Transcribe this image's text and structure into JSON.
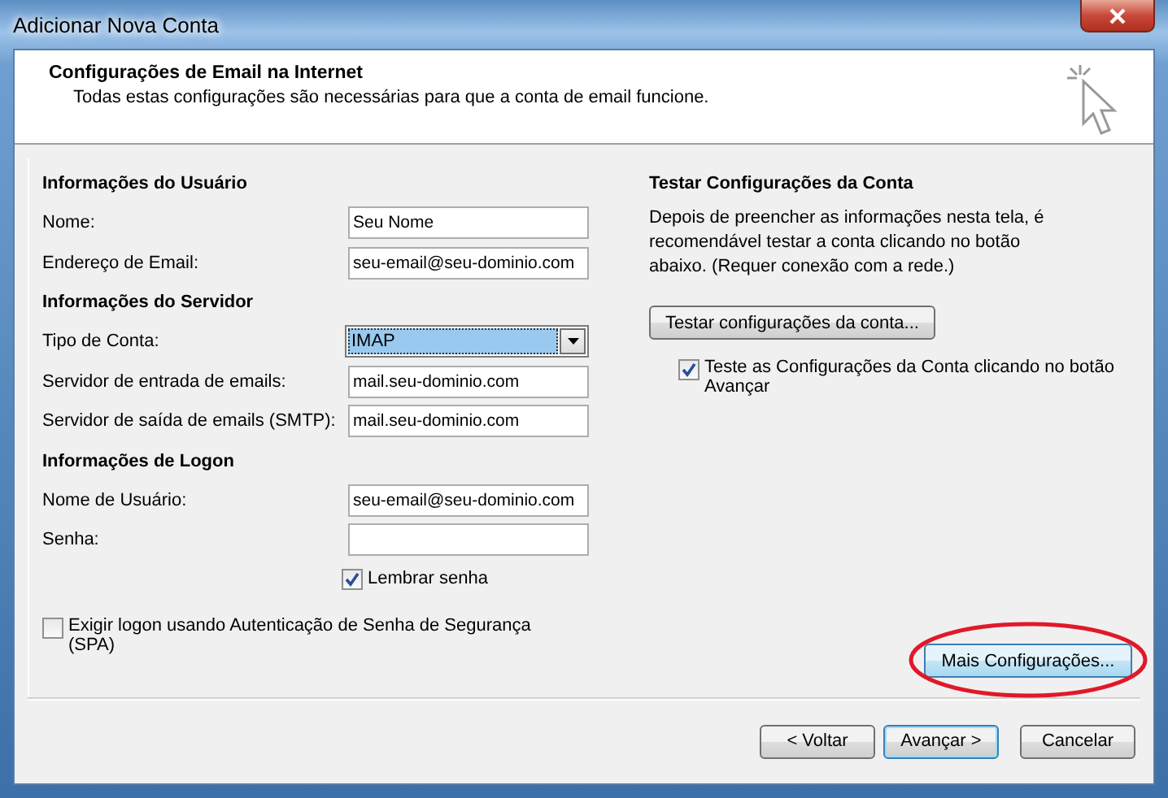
{
  "window": {
    "title": "Adicionar Nova Conta"
  },
  "header": {
    "title": "Configurações de Email na Internet",
    "subtitle": "Todas estas configurações são necessárias para que a conta de email funcione."
  },
  "sections": [
    {
      "title": "Informações do Usuário",
      "rows": [
        {
          "kind": "text",
          "label": "Nome:",
          "value": "Seu Nome"
        },
        {
          "kind": "text",
          "label": "Endereço de Email:",
          "value": "seu-email@seu-dominio.com"
        }
      ]
    },
    {
      "title": "Informações do Servidor",
      "rows": [
        {
          "kind": "select",
          "label": "Tipo de Conta:",
          "value": "IMAP"
        },
        {
          "kind": "text",
          "label": "Servidor de entrada de emails:",
          "value": "mail.seu-dominio.com"
        },
        {
          "kind": "text",
          "label": "Servidor de saída de emails (SMTP):",
          "value": "mail.seu-dominio.com"
        }
      ]
    },
    {
      "title": "Informações de Logon",
      "rows": [
        {
          "kind": "text",
          "label": "Nome de Usuário:",
          "value": "seu-email@seu-dominio.com"
        },
        {
          "kind": "password",
          "label": "Senha:"
        },
        {
          "kind": "checkbox",
          "label": "Lembrar senha",
          "checked": true
        }
      ]
    }
  ],
  "spa": {
    "label": "Exigir logon usando Autenticação de Senha de Segurança (SPA)",
    "checked": false
  },
  "test": {
    "title": "Testar Configurações da Conta",
    "description": "Depois de preencher as informações nesta tela, é recomendável testar a conta clicando no botão abaixo. (Requer conexão com a rede.)",
    "button": "Testar configurações da conta...",
    "checkbox": {
      "label": "Teste as Configurações da Conta clicando no botão Avançar",
      "checked": true
    }
  },
  "more_settings": {
    "label": "Mais Configurações...",
    "highlighted": true
  },
  "buttons": [
    {
      "label": "< Voltar",
      "default": false
    },
    {
      "label": "Avançar >",
      "default": true
    },
    {
      "label": "Cancelar",
      "default": false
    }
  ]
}
